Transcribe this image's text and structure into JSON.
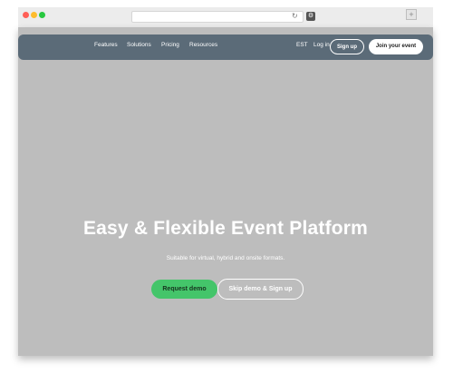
{
  "browser": {
    "reload_glyph": "↻",
    "extension_glyph": "⚙",
    "newtab_glyph": "+"
  },
  "nav": {
    "links": [
      "Features",
      "Solutions",
      "Pricing",
      "Resources"
    ],
    "language": "EST",
    "login": "Log in",
    "signup": "Sign up",
    "join": "Join your event"
  },
  "hero": {
    "title": "Easy & Flexible Event Platform",
    "subtitle": "Suitable for virtual, hybrid and onsite formats.",
    "primary_cta": "Request demo",
    "secondary_cta": "Skip demo & Sign up"
  },
  "colors": {
    "navbar": "#5b6b78",
    "hero_bg": "#bdbdbd",
    "primary_cta": "#44c56a"
  }
}
